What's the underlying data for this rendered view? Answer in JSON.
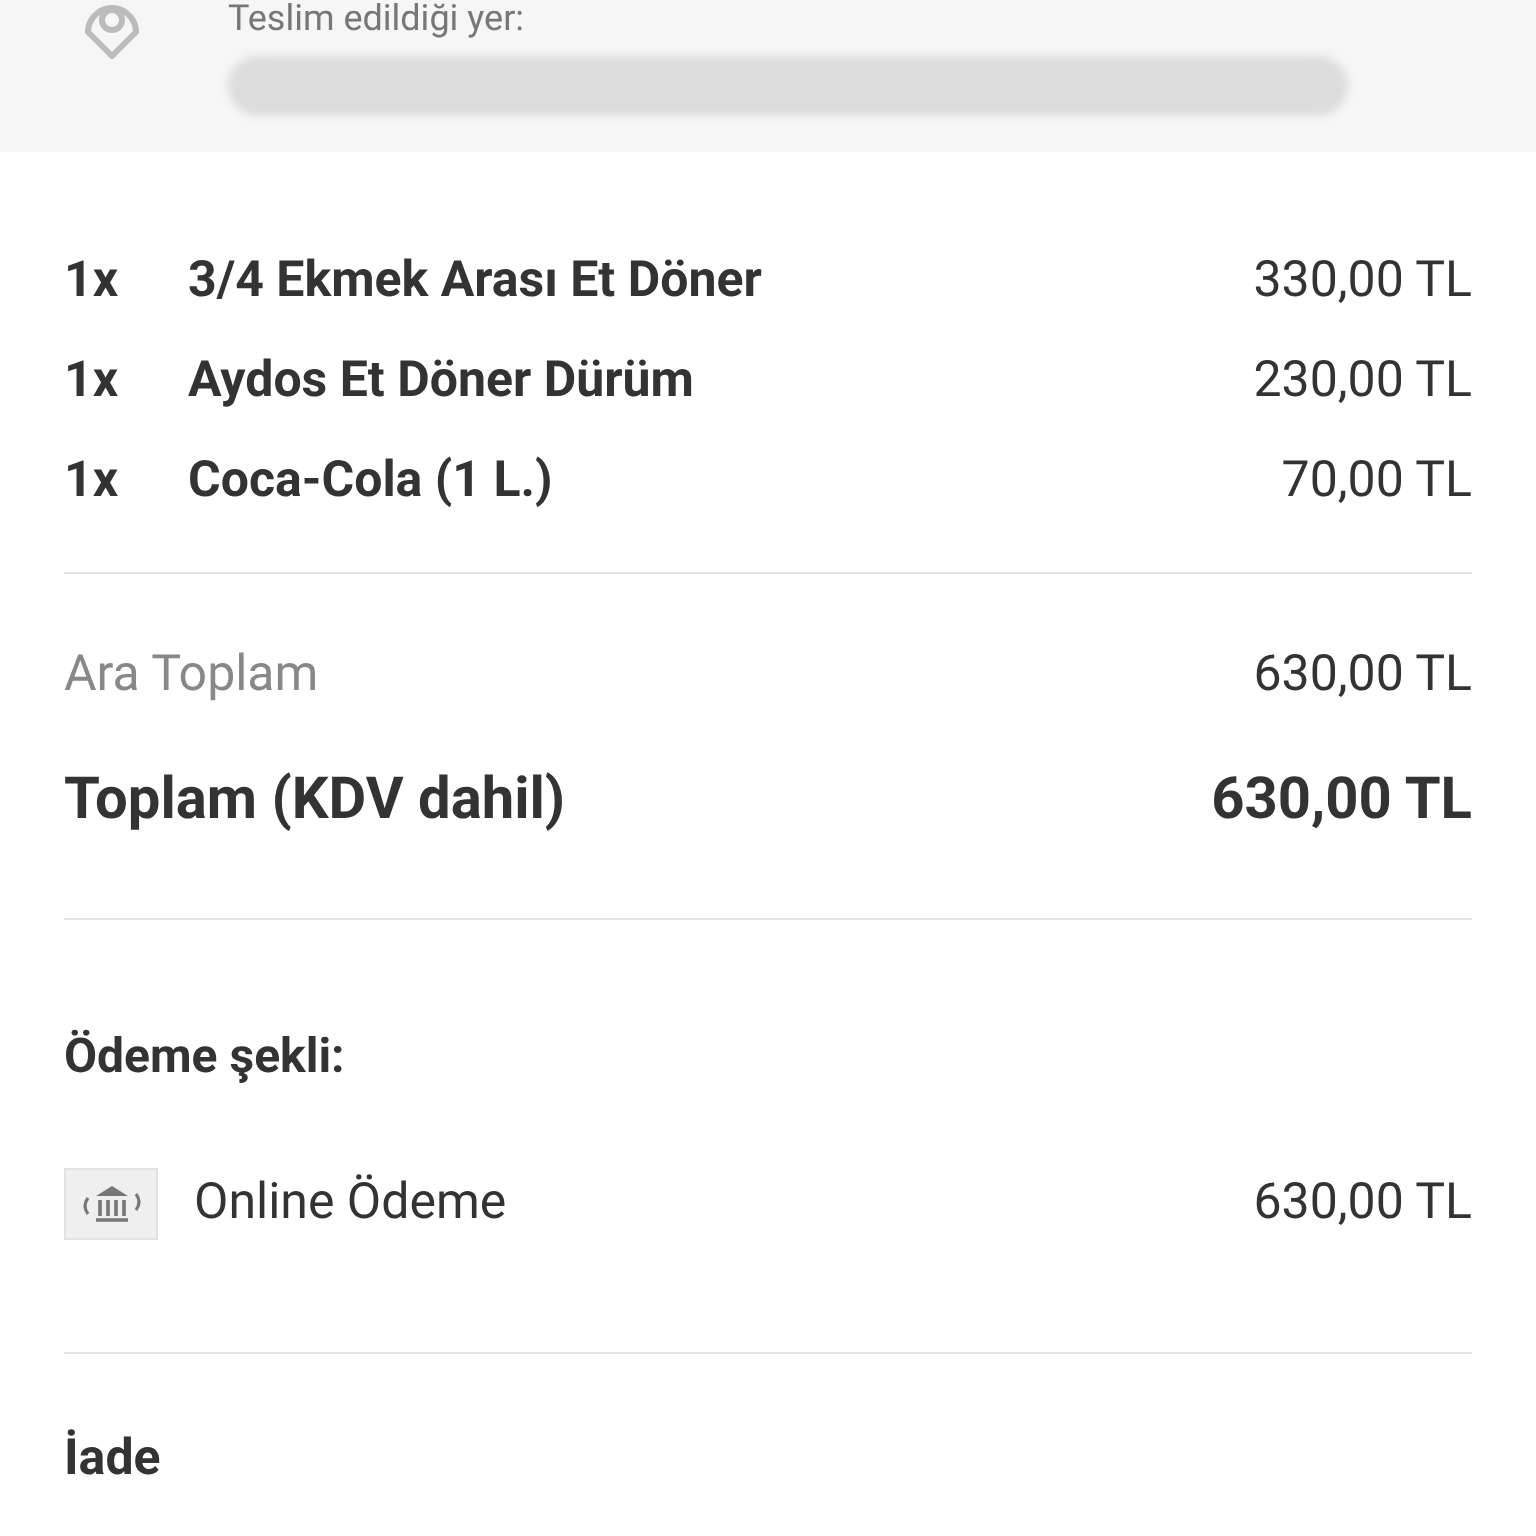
{
  "delivery": {
    "label": "Teslim edildiği yer:"
  },
  "items": [
    {
      "qty": "1x",
      "name": "3/4 Ekmek Arası Et Döner",
      "price": "330,00 TL"
    },
    {
      "qty": "1x",
      "name": "Aydos Et Döner Dürüm",
      "price": "230,00 TL"
    },
    {
      "qty": "1x",
      "name": "Coca-Cola (1 L.)",
      "price": "70,00 TL"
    }
  ],
  "subtotal": {
    "label": "Ara Toplam",
    "value": "630,00 TL"
  },
  "total": {
    "label": "Toplam (KDV dahil)",
    "value": "630,00 TL"
  },
  "payment": {
    "heading": "Ödeme şekli:",
    "method": "Online Ödeme",
    "amount": "630,00 TL"
  },
  "refund": {
    "heading": "İade"
  }
}
